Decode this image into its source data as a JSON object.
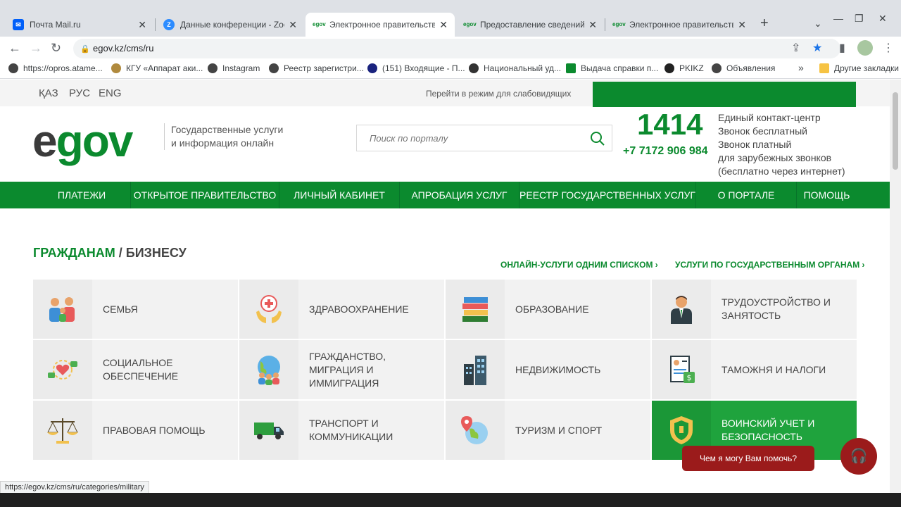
{
  "browser": {
    "tabs": [
      {
        "title": "Почта Mail.ru",
        "icon": "mail-icon",
        "color": "#005ff9"
      },
      {
        "title": "Данные конференции - Zoom",
        "icon": "zoom-icon",
        "color": "#2d8cff"
      },
      {
        "title": "Электронное правительство",
        "icon": "egov-icon",
        "color": "#0b8a2e"
      },
      {
        "title": "Предоставление сведений о",
        "icon": "egov-icon",
        "color": "#0b8a2e"
      },
      {
        "title": "Электронное правительство",
        "icon": "egov-icon",
        "color": "#0b8a2e"
      }
    ],
    "url": "egov.kz/cms/ru",
    "bookmarks": [
      "https://opros.atame...",
      "КГУ «Аппарат аки...",
      "Instagram",
      "Реестр зарегистри...",
      "(151) Входящие - П...",
      "Национальный уд...",
      "Выдача справки п...",
      "PKIKZ",
      "Объявления"
    ],
    "bookmarks_overflow": "»",
    "other_bookmarks": "Другие закладки",
    "status_url": "https://egov.kz/cms/ru/categories/military"
  },
  "site": {
    "languages": [
      "ҚАЗ",
      "РУС",
      "ENG"
    ],
    "low_vision": "Перейти в режим для слабовидящих",
    "logo_e": "e",
    "logo_gov": "gov",
    "tagline": [
      "Государственные услуги",
      "и информация онлайн"
    ],
    "search_placeholder": "Поиск по порталу",
    "hotline": "1414",
    "phone": "+7 7172 906 984",
    "contact": [
      "Единый контакт-центр",
      "Звонок бесплатный",
      "Звонок платный",
      "для зарубежных звонков",
      "(бесплатно через интернет)"
    ],
    "nav": [
      "ПЛАТЕЖИ",
      "ОТКРЫТОЕ ПРАВИТЕЛЬСТВО",
      "ЛИЧНЫЙ КАБИНЕТ",
      "АПРОБАЦИЯ УСЛУГ",
      "РЕЕСТР ГОСУДАРСТВЕННЫХ УСЛУГ",
      "О ПОРТАЛЕ",
      "ПОМОЩЬ"
    ],
    "heading_citizens": "ГРАЖДАНАМ",
    "heading_sep": "/",
    "heading_business": "БИЗНЕСУ",
    "link_all_services": "ОНЛАЙН-УСЛУГИ ОДНИМ СПИСКОМ ›",
    "link_by_agency": "УСЛУГИ ПО ГОСУДАРСТВЕННЫМ ОРГАНАМ ›",
    "categories": [
      {
        "label": "СЕМЬЯ",
        "icon": "family-icon"
      },
      {
        "label": "ЗДРАВООХРАНЕНИЕ",
        "icon": "healthcare-icon"
      },
      {
        "label": "ОБРАЗОВАНИЕ",
        "icon": "books-icon"
      },
      {
        "label": "ТРУДОУСТРОЙСТВО И ЗАНЯТОСТЬ",
        "icon": "employee-icon"
      },
      {
        "label": "СОЦИАЛЬНОЕ ОБЕСПЕЧЕНИЕ",
        "icon": "social-care-icon"
      },
      {
        "label": "ГРАЖДАНСТВО, МИГРАЦИЯ И ИММИГРАЦИЯ",
        "icon": "globe-people-icon"
      },
      {
        "label": "НЕДВИЖИМОСТЬ",
        "icon": "buildings-icon"
      },
      {
        "label": "ТАМОЖНЯ И НАЛОГИ",
        "icon": "tax-document-icon"
      },
      {
        "label": "ПРАВОВАЯ ПОМОЩЬ",
        "icon": "scales-icon"
      },
      {
        "label": "ТРАНСПОРТ И КОММУНИКАЦИИ",
        "icon": "truck-icon"
      },
      {
        "label": "ТУРИЗМ И СПОРТ",
        "icon": "travel-globe-icon"
      },
      {
        "label": "ВОИНСКИЙ УЧЕТ И БЕЗОПАСНОСТЬ",
        "icon": "shield-icon"
      }
    ],
    "chat_prompt": "Чем я могу Вам помочь?"
  },
  "colors": {
    "brand_green": "#0b8a2e",
    "highlight_green": "#1fa33d",
    "chat_red": "#9b1b1b"
  }
}
